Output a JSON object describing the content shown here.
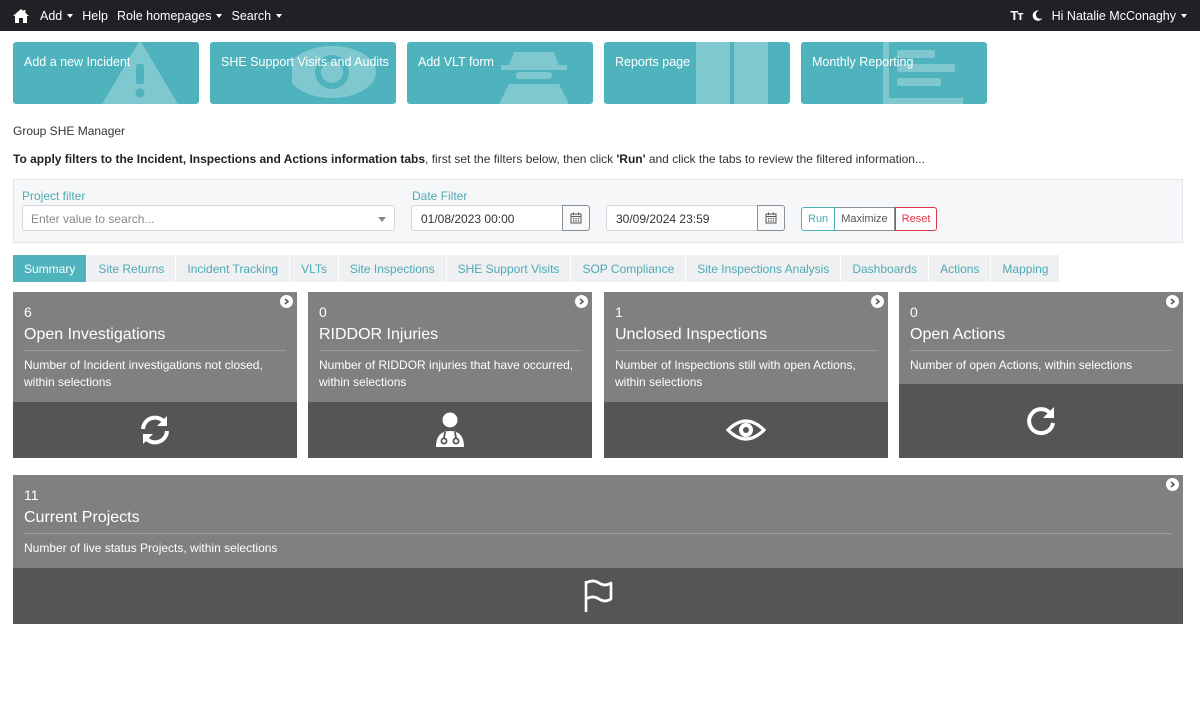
{
  "navbar": {
    "home_icon": "home-icon",
    "items": [
      {
        "label": "Add",
        "dropdown": true
      },
      {
        "label": "Help",
        "dropdown": false
      },
      {
        "label": "Role homepages",
        "dropdown": true
      },
      {
        "label": "Search",
        "dropdown": true
      }
    ],
    "text_size_label": "Tт",
    "theme_icon": "moon-icon",
    "user_greeting": "Hi Natalie McConaghy"
  },
  "tiles": [
    {
      "label": "Add a new Incident",
      "icon": "warning-icon"
    },
    {
      "label": "SHE Support Visits and Audits",
      "icon": "eye-icon"
    },
    {
      "label": "Add VLT form",
      "icon": "spy-icon"
    },
    {
      "label": "Reports page",
      "icon": "book-icon"
    },
    {
      "label": "Monthly Reporting",
      "icon": "list-icon"
    }
  ],
  "role_label": "Group SHE Manager",
  "instructions": {
    "bold_1": "To apply filters to the Incident, Inspections and Actions information tabs",
    "text_1": ", first set the filters below, then click ",
    "bold_2": "'Run'",
    "text_2": " and click the tabs to review the filtered information..."
  },
  "filters": {
    "project_label": "Project filter",
    "project_placeholder": "Enter value to search...",
    "date_label": "Date Filter",
    "date_from": "01/08/2023 00:00",
    "date_to": "30/09/2024 23:59",
    "run_label": "Run",
    "maximize_label": "Maximize",
    "reset_label": "Reset"
  },
  "tabs": [
    {
      "label": "Summary",
      "active": true
    },
    {
      "label": "Site Returns",
      "active": false
    },
    {
      "label": "Incident Tracking",
      "active": false
    },
    {
      "label": "VLTs",
      "active": false
    },
    {
      "label": "Site Inspections",
      "active": false
    },
    {
      "label": "SHE Support Visits",
      "active": false
    },
    {
      "label": "SOP Compliance",
      "active": false
    },
    {
      "label": "Site Inspections Analysis",
      "active": false
    },
    {
      "label": "Dashboards",
      "active": false
    },
    {
      "label": "Actions",
      "active": false
    },
    {
      "label": "Mapping",
      "active": false
    }
  ],
  "cards": [
    {
      "count": "6",
      "title": "Open Investigations",
      "line1": "Number of Incident investigations not closed,",
      "line2": "within selections",
      "icon": "refresh-icon"
    },
    {
      "count": "0",
      "title": "RIDDOR Injuries",
      "line1": "Number of RIDDOR injuries that have occurred,",
      "line2": "within selections",
      "icon": "doctor-icon"
    },
    {
      "count": "1",
      "title": "Unclosed Inspections",
      "line1": "Number of Inspections still with open Actions,",
      "line2": "within selections",
      "icon": "eye-icon"
    },
    {
      "count": "0",
      "title": "Open Actions",
      "line1": "Number of open Actions, within selections",
      "line2": "",
      "icon": "redo-icon"
    },
    {
      "count": "11",
      "title": "Current Projects",
      "line1": "Number of live status Projects, within selections",
      "line2": "",
      "icon": "flag-icon"
    }
  ],
  "colors": {
    "teal": "#4eb3bd",
    "navbar": "#1f2125",
    "card_top": "#808080",
    "card_bottom": "#555553",
    "reset": "#dc3545"
  }
}
